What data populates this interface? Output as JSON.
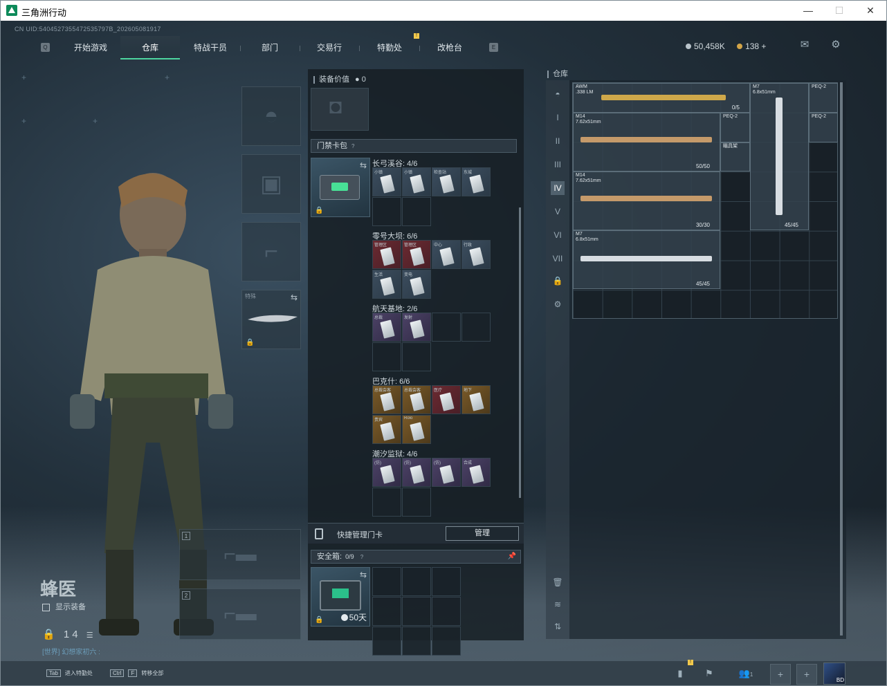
{
  "window": {
    "title": "三角洲行动",
    "controls": [
      "—",
      "☐",
      "✕"
    ]
  },
  "uid": "CN UID:5404527355472535797B_202605081917",
  "nav": {
    "tabs": [
      "开始游戏",
      "仓库",
      "特战干员",
      "部门",
      "交易行",
      "特勤处",
      "改枪台"
    ],
    "active_index": 1,
    "badge": "!"
  },
  "currency": {
    "coins": "50,458K",
    "bonds": "138 +"
  },
  "operator": {
    "name": "蜂医",
    "show_equip": "显示装备",
    "level": "14",
    "chat": "[世界] 幻想家初六 :"
  },
  "slots": {
    "melee_label": "特殊",
    "primary_num": "1",
    "secondary_num": "2"
  },
  "middle": {
    "equip_value_label": "装备价值",
    "equip_value": "0",
    "keybag_title": "门禁卡包",
    "keybag_help": "?",
    "maps": [
      {
        "name": "长弓溪谷: 4/6",
        "cells": [
          {
            "label": "小镇",
            "style": "k"
          },
          {
            "label": "小镇",
            "style": "k"
          },
          {
            "label": "检查站",
            "style": "k"
          },
          {
            "label": "东城",
            "style": "k"
          }
        ]
      },
      {
        "name": "零号大坝: 6/6",
        "cells": [
          {
            "label": "管理区",
            "style": "red"
          },
          {
            "label": "管理区",
            "style": "red"
          },
          {
            "label": "中心",
            "style": "k"
          },
          {
            "label": "行政",
            "style": "k"
          },
          {
            "label": "生活",
            "style": "k"
          },
          {
            "label": "变电",
            "style": "k"
          }
        ]
      },
      {
        "name": "航天基地: 2/6",
        "cells": [
          {
            "label": "总裁",
            "style": "purple"
          },
          {
            "label": "发射",
            "style": "purple"
          }
        ]
      },
      {
        "name": "巴克什: 6/6",
        "cells": [
          {
            "label": "总裁会客",
            "style": "gold"
          },
          {
            "label": "总裁会客",
            "style": "gold"
          },
          {
            "label": "医疗",
            "style": "red"
          },
          {
            "label": "地下",
            "style": "gold"
          },
          {
            "label": "贵宾",
            "style": "gold"
          },
          {
            "label": "Rolo",
            "style": "gold"
          }
        ]
      },
      {
        "name": "潮汐监狱: 4/6",
        "cells": [
          {
            "label": "(仿)",
            "style": "purple"
          },
          {
            "label": "(仿)",
            "style": "purple"
          },
          {
            "label": "(仿)",
            "style": "purple"
          },
          {
            "label": "合成",
            "style": "purple"
          }
        ]
      }
    ],
    "quick_manage": "快捷管理门卡",
    "manage_button": "管理",
    "safe_title": "安全箱:",
    "safe_count": "0/9",
    "safe_help": "?",
    "safe_days": "50天"
  },
  "warehouse": {
    "title": "仓库",
    "items": [
      {
        "name": "AWM",
        "sub": ".338 LM",
        "amount": "0/5"
      },
      {
        "name": "M7",
        "sub": "6.8x51mm",
        "amount": "45/45"
      },
      {
        "name": "PEQ-2",
        "sub": "",
        "amount": ""
      },
      {
        "name": "M14",
        "sub": "7.62x51mm",
        "amount": "50/50"
      },
      {
        "name": "PEQ-2",
        "sub": "",
        "amount": ""
      },
      {
        "name": "PEQ-2",
        "sub": "",
        "amount": ""
      },
      {
        "name": "瞄具架",
        "sub": "",
        "amount": ""
      },
      {
        "name": "M14",
        "sub": "7.62x51mm",
        "amount": "30/30"
      },
      {
        "name": "M7",
        "sub": "6.8x51mm",
        "amount": "45/45"
      }
    ]
  },
  "bottom": {
    "tab_hint_key": "Tab",
    "tab_hint": "进入特勤处",
    "ctrl_key": "Ctrl",
    "f_key": "F",
    "ctrl_hint": "转移全部",
    "badge": "!",
    "friends": "1",
    "avatar_text": "BD"
  },
  "colors": {
    "accent": "#4dd6a0",
    "gold": "#d3a548",
    "badge": "#f2c94c"
  }
}
